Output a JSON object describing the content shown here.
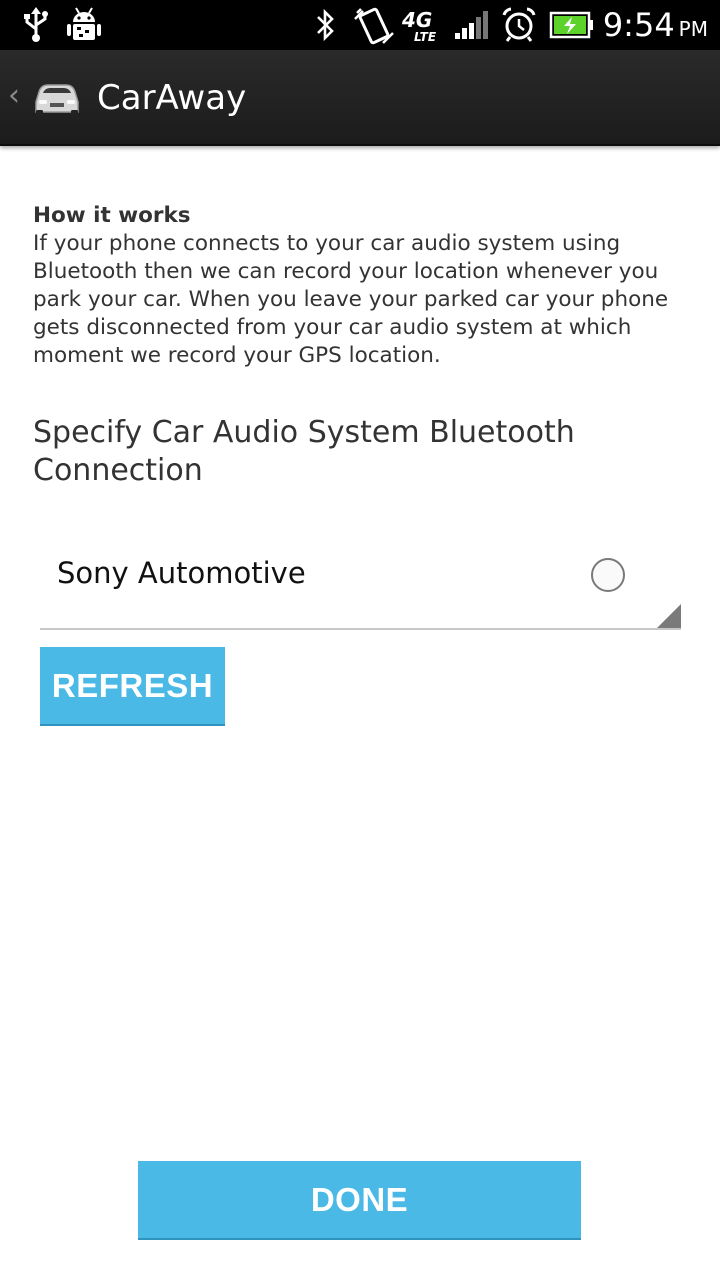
{
  "status_bar": {
    "time": "9:54",
    "ampm": "PM",
    "network": "4G LTE",
    "icons": [
      "usb-icon",
      "android-debug-icon",
      "bluetooth-icon",
      "vibrate-icon",
      "4g-lte-icon",
      "signal-icon",
      "alarm-icon",
      "battery-charging-icon"
    ],
    "battery_color": "#5cd22b"
  },
  "action_bar": {
    "title": "CarAway",
    "icon": "car-icon"
  },
  "info": {
    "heading": "How it works",
    "body": "If your phone connects to your car audio system using Bluetooth then we can record your location whenever you park your car. When you leave your parked car your phone gets disconnected from your car audio system at which moment we record your GPS location."
  },
  "section": {
    "title": "Specify Car Audio System Bluetooth Connection"
  },
  "device_spinner": {
    "selected": "Sony Automotive",
    "checked": false
  },
  "buttons": {
    "refresh": "REFRESH",
    "done": "DONE"
  },
  "colors": {
    "accent": "#4ab9e6",
    "action_bar": "#222222",
    "status_bar": "#000000"
  }
}
